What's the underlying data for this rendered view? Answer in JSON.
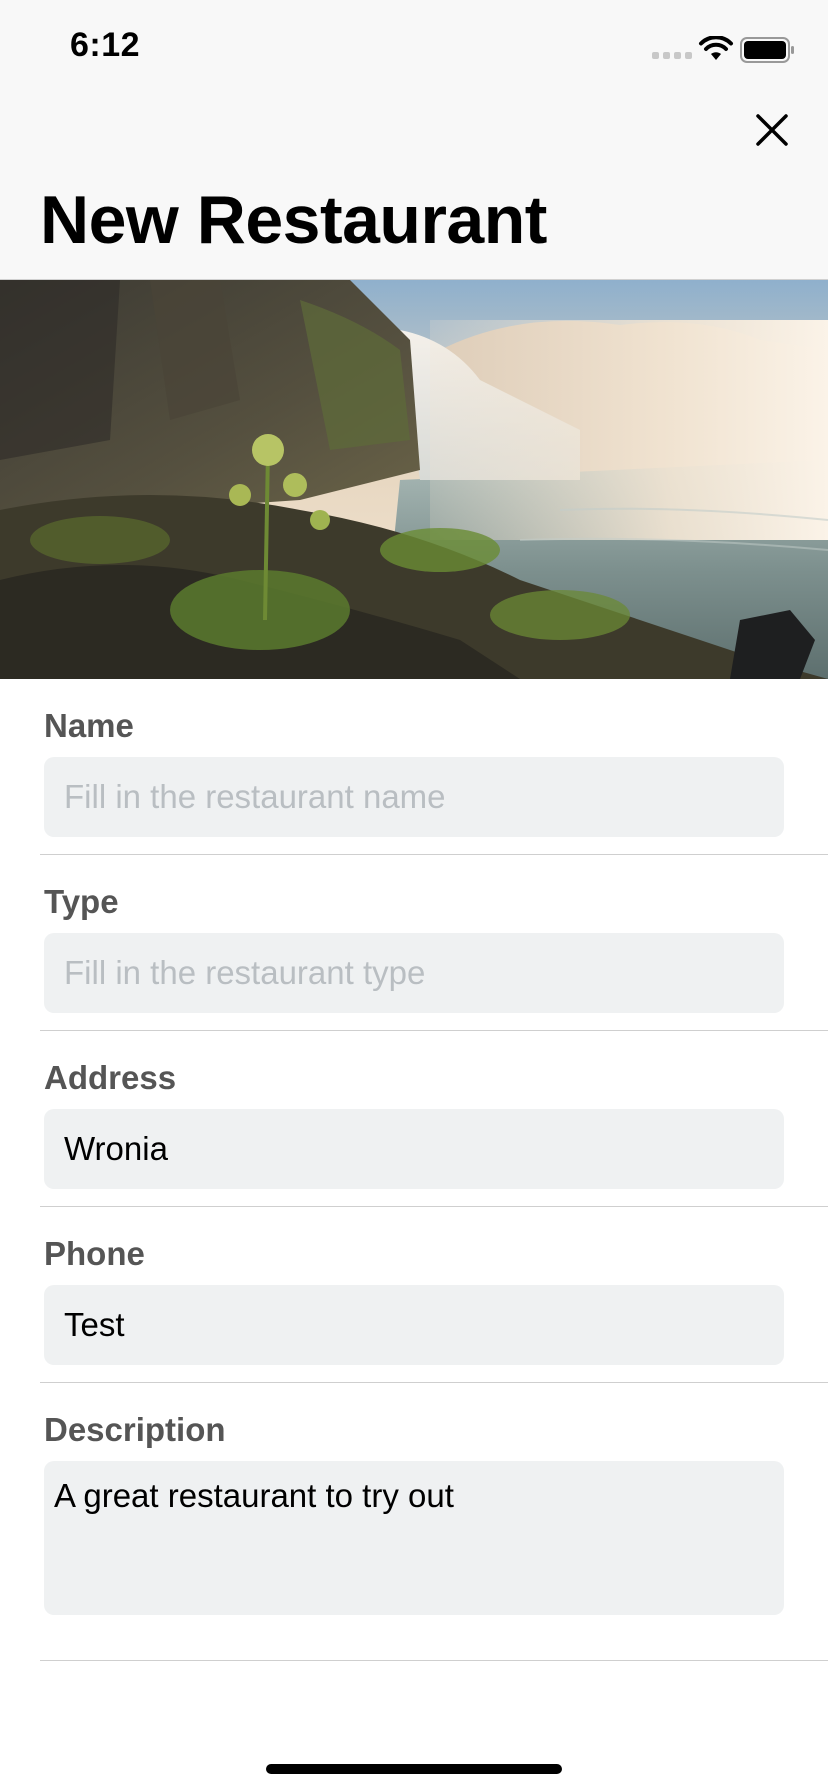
{
  "status_bar": {
    "time": "6:12"
  },
  "header": {
    "title": "New Restaurant",
    "close_icon": "close-icon"
  },
  "hero_image": {
    "description_icon": "waterfall-photo"
  },
  "form": {
    "fields": [
      {
        "label": "Name",
        "value": "",
        "placeholder": "Fill in the restaurant name"
      },
      {
        "label": "Type",
        "value": "",
        "placeholder": "Fill in the restaurant type"
      },
      {
        "label": "Address",
        "value": "Wronia",
        "placeholder": ""
      },
      {
        "label": "Phone",
        "value": "Test",
        "placeholder": ""
      }
    ],
    "description": {
      "label": "Description",
      "value": "A great restaurant to try out"
    }
  },
  "colors": {
    "header_bg": "#f8f8f8",
    "input_bg": "#eff1f2",
    "label_color": "#555555",
    "placeholder_color": "#b9bec2"
  }
}
